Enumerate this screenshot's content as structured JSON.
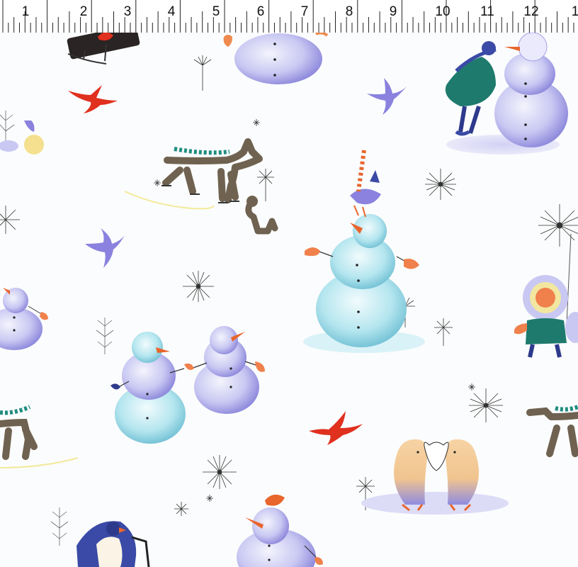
{
  "ruler": {
    "numbers": [
      "1",
      "2",
      "3",
      "4",
      "5",
      "6",
      "7",
      "8",
      "9",
      "10",
      "11",
      "12",
      "1"
    ]
  },
  "palette": {
    "background": "#fbfcfd",
    "snowman_lavender": "#c9c8f2",
    "snowman_aqua": "#c4ecf2",
    "bird_red": "#e0301e",
    "bird_blue": "#8a82de",
    "scarf_teal": "#1f8d80",
    "dog_brown": "#6f6250",
    "mitten_orange": "#f0804c",
    "penguin_peach": "#f3c795",
    "coat_green": "#1e7a6d"
  },
  "motifs": [
    "sled-with-red-bird",
    "snowman-top",
    "red-bird",
    "blue-bird",
    "girl-kissing-snowman",
    "skating-dog",
    "small-dog",
    "snowman-with-birds",
    "snowman-partial",
    "snowmen-holding-hands",
    "red-bird",
    "penguins-heart",
    "penguin-sledding",
    "snowman-with-bird",
    "child-with-dandelion",
    "snowflakes",
    "winter-twigs"
  ]
}
